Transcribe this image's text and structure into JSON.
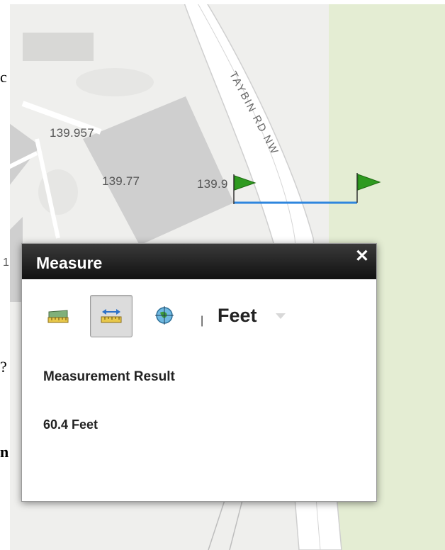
{
  "document": {
    "chars": [
      "c",
      "1",
      "?",
      "n"
    ]
  },
  "map": {
    "road_name": "TAYBIN RD NW",
    "elevations": [
      "139.957",
      "139.77",
      "139.9"
    ],
    "colors": {
      "background": "#efefed",
      "building": "#cfcfcf",
      "road": "#ffffff",
      "park": "#e4edd3",
      "measure_line": "#2e86de",
      "flag": "#2e9a1f"
    }
  },
  "panel": {
    "title": "Measure",
    "close_icon": "close-icon",
    "tools": [
      {
        "name": "area-tool",
        "icon": "area-measure-icon",
        "active": false
      },
      {
        "name": "distance-tool",
        "icon": "distance-measure-icon",
        "active": true
      },
      {
        "name": "location-tool",
        "icon": "location-icon",
        "active": false
      }
    ],
    "separator": "|",
    "unit": "Feet",
    "result_label": "Measurement Result",
    "result_value": "60.4 Feet"
  }
}
